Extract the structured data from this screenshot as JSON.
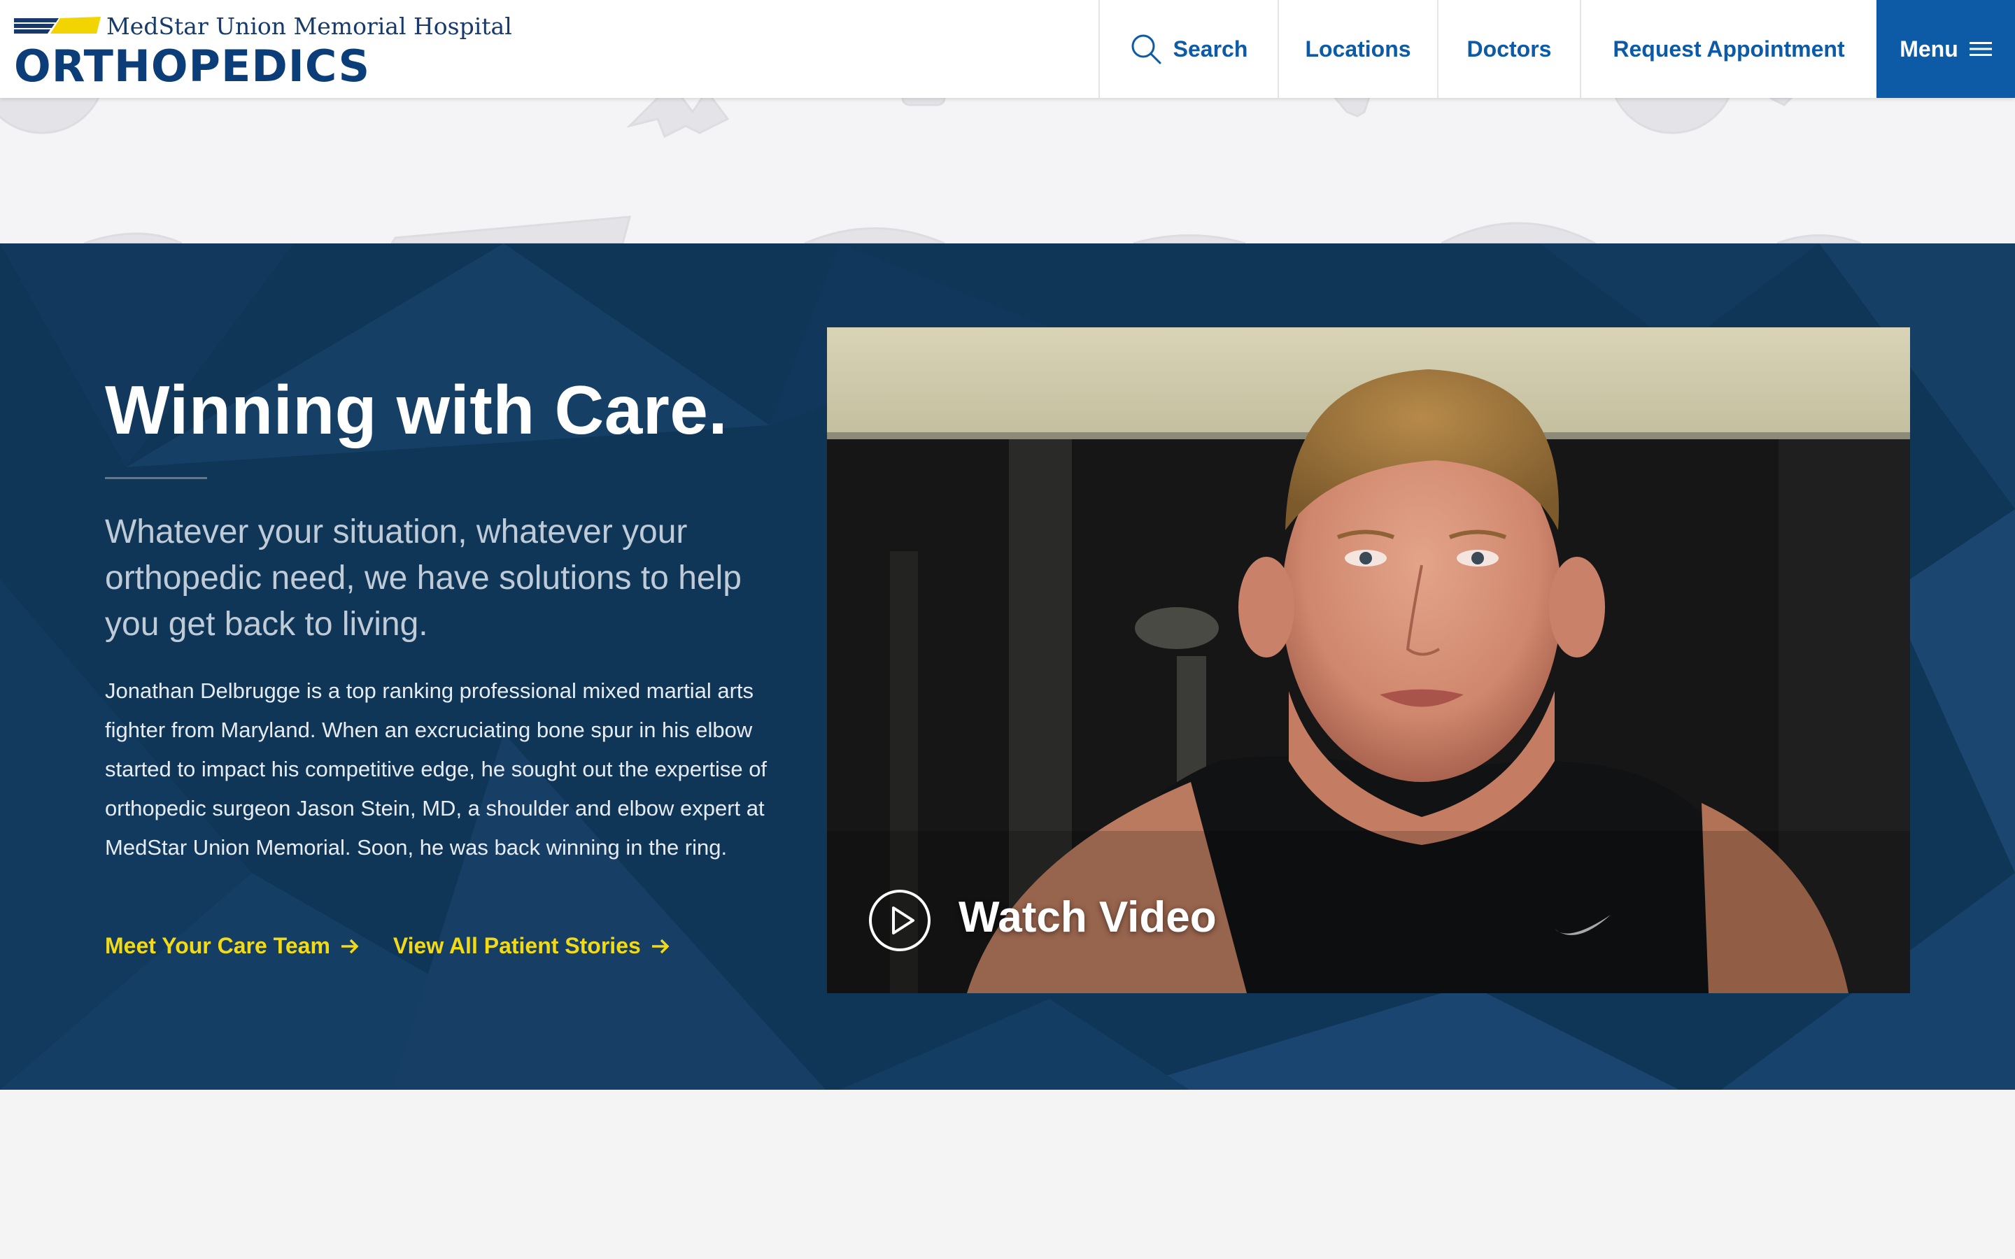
{
  "header": {
    "hospital_name": "MedStar Union Memorial Hospital",
    "department": "ORTHOPEDICS",
    "logo_icon": "medstar-logo-icon",
    "nav": {
      "search": "Search",
      "locations": "Locations",
      "doctors": "Doctors",
      "request": "Request Appointment",
      "menu": "Menu"
    }
  },
  "hero": {
    "title": "Winning with Care.",
    "subtitle": "Whatever your situation, whatever your orthopedic need, we have solutions to help you get back to living.",
    "body": "Jonathan Delbrugge is a top ranking professional mixed martial arts fighter from Maryland. When an excruciating bone spur in his elbow started to impact his competitive edge, he sought out the expertise of orthopedic surgeon Jason Stein, MD, a shoulder and elbow expert at MedStar Union Memorial. Soon, he was back winning in the ring.",
    "links": {
      "care_team": "Meet Your Care Team",
      "patient_stories": "View All Patient Stories"
    },
    "video": {
      "label": "Watch Video",
      "play_icon": "play-icon"
    }
  },
  "colors": {
    "navy": "#0f3557",
    "brand_blue": "#0d5aa7",
    "accent_yellow": "#f2da16",
    "white": "#ffffff"
  }
}
